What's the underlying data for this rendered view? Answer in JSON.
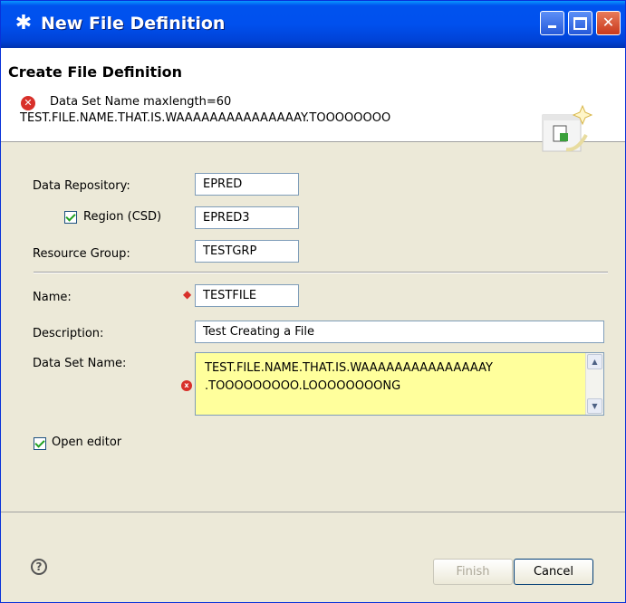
{
  "window": {
    "title": "New File Definition",
    "controls": {
      "minimize_icon": "minimize-icon",
      "maximize_icon": "maximize-icon",
      "close_icon": "close-icon"
    }
  },
  "banner": {
    "title": "Create File Definition",
    "error_line1": "Data Set Name maxlength=60",
    "error_line2": "TEST.FILE.NAME.THAT.IS.WAAAAAAAAAAAAAAAY.TOOOOOOOO",
    "error_icon": "error-icon"
  },
  "form": {
    "data_repository": {
      "label": "Data Repository:",
      "value": "EPRED"
    },
    "region": {
      "label": "Region (CSD)",
      "checked": true,
      "value": "EPRED3"
    },
    "resource_group": {
      "label": "Resource Group:",
      "value": "TESTGRP"
    },
    "name": {
      "label": "Name:",
      "value": "TESTFILE",
      "required_marker": "◆"
    },
    "description": {
      "label": "Description:",
      "value": "Test Creating a File"
    },
    "data_set_name": {
      "label": "Data Set Name:",
      "line1": "TEST.FILE.NAME.THAT.IS.WAAAAAAAAAAAAAAAY",
      "line2": ".TOOOOOOOOO.LOOOOOOOONG",
      "error_marker": "x"
    },
    "open_editor": {
      "label": "Open editor",
      "checked": true
    }
  },
  "footer": {
    "help_label": "?",
    "finish_label": "Finish",
    "finish_enabled": false,
    "cancel_label": "Cancel"
  },
  "colors": {
    "title_bar": "#0053ee",
    "error": "#d8302a",
    "textarea_error_bg": "#ffff9c",
    "dialog_bg": "#ece9d8"
  }
}
